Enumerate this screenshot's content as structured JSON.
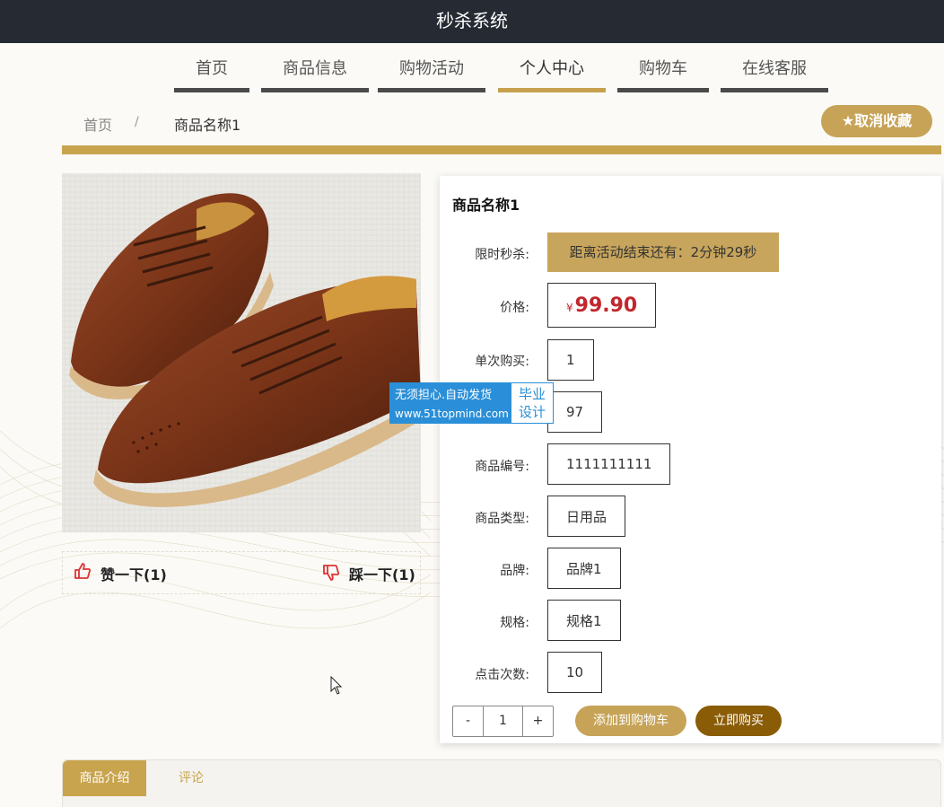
{
  "app": {
    "title": "秒杀系统"
  },
  "nav": {
    "items": [
      {
        "label": "首页"
      },
      {
        "label": "商品信息"
      },
      {
        "label": "购物活动"
      },
      {
        "label": "个人中心"
      },
      {
        "label": "购物车"
      },
      {
        "label": "在线客服"
      }
    ],
    "active": "个人中心"
  },
  "breadcrumb": {
    "home": "首页",
    "separator": "/",
    "current": "商品名称1"
  },
  "favorite_button": {
    "label": "取消收藏",
    "icon": "star-icon"
  },
  "votes": {
    "like": {
      "label": "赞一下(1)",
      "icon": "thumbs-up-icon"
    },
    "dislike": {
      "label": "踩一下(1)",
      "icon": "thumbs-down-icon"
    }
  },
  "product": {
    "name": "商品名称1",
    "seckill_label": "限时秒杀:",
    "countdown": "距离活动结束还有：2分钟29秒",
    "price_label": "价格:",
    "currency": "¥",
    "price": "99.90",
    "per_purchase_label": "单次购买:",
    "per_purchase": "1",
    "stock": "97",
    "code_label": "商品编号:",
    "code": "1111111111",
    "type_label": "商品类型:",
    "type": "日用品",
    "brand_label": "品牌:",
    "brand": "品牌1",
    "spec_label": "规格:",
    "spec": "规格1",
    "clicks_label": "点击次数:",
    "clicks": "10"
  },
  "quantity": {
    "minus": "-",
    "value": "1",
    "plus": "+"
  },
  "actions": {
    "add_to_cart": "添加到购物车",
    "buy_now": "立即购买"
  },
  "watermark": {
    "line1": "无须担心.自动发货",
    "url": "www.51topmind.com",
    "badge1": "毕业",
    "badge2": "设计"
  },
  "tabs": [
    {
      "label": "商品介绍"
    },
    {
      "label": "评论"
    }
  ],
  "colors": {
    "gold": "#c8a44e",
    "dark": "#252a33",
    "price_red": "#c1272d",
    "buy_brown": "#8a5c06"
  }
}
